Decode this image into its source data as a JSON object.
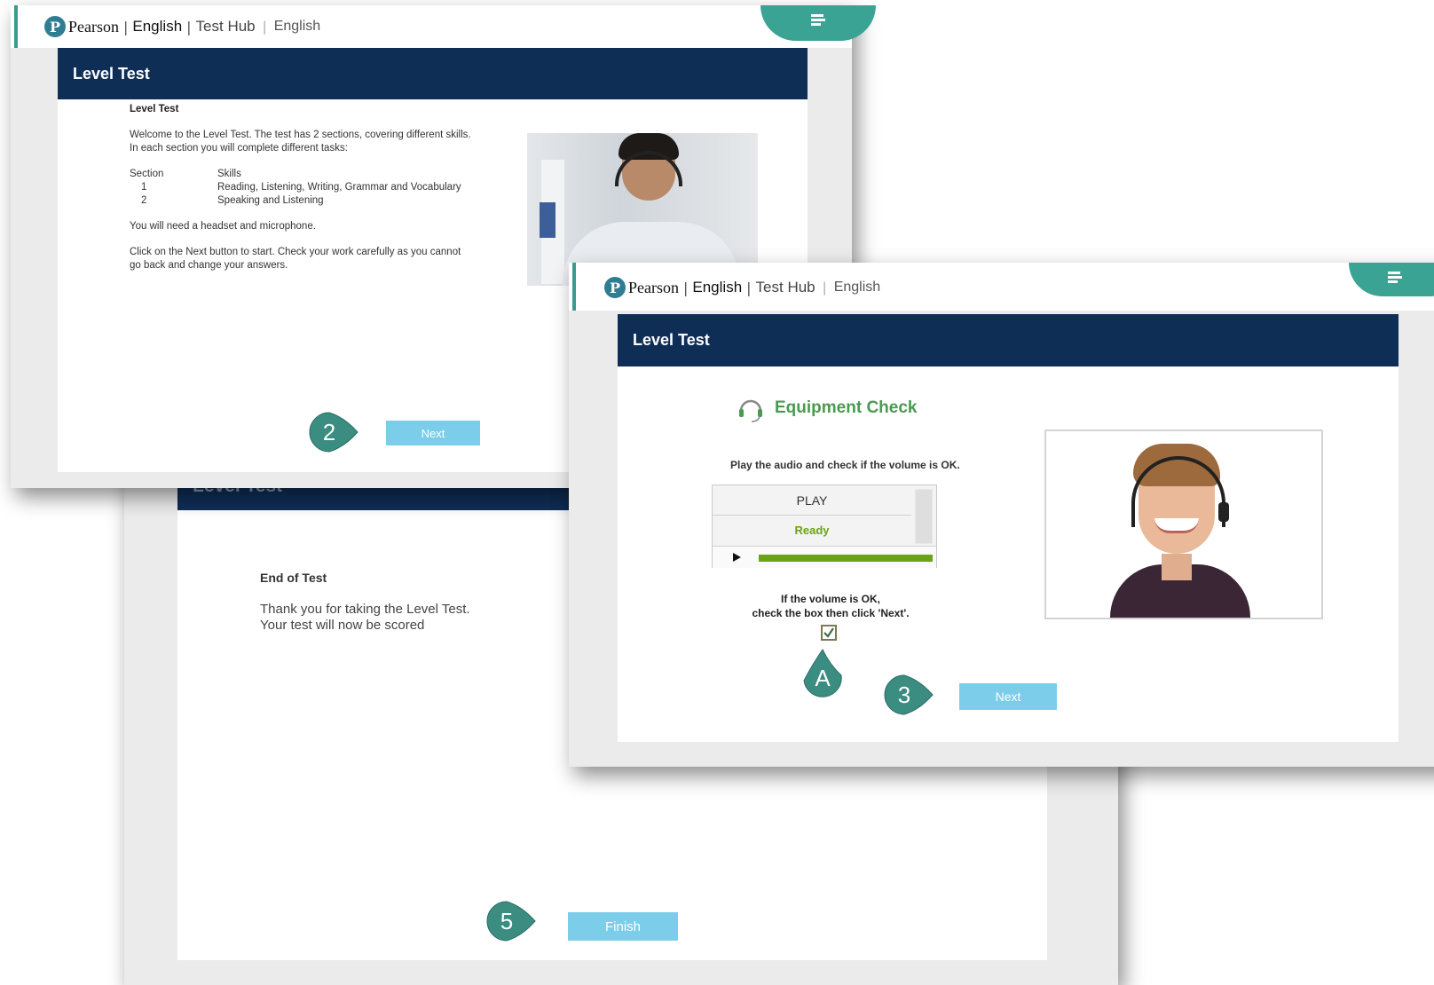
{
  "brand": {
    "logo_letter": "P",
    "pearson": "Pearson",
    "english": "English",
    "test_hub": "Test Hub",
    "language": "English",
    "separator": "|"
  },
  "colors": {
    "title_bar": "#0f2e56",
    "teal": "#3aa394",
    "button": "#7ccdea",
    "equipment_green": "#4a9a4f",
    "ready_green": "#6aa315"
  },
  "screen_end": {
    "title": "Level Test",
    "heading": "End of Test",
    "line1": "Thank you for taking the Level Test.",
    "line2": "Your test will now be scored",
    "finish_label": "Finish",
    "step": "5"
  },
  "screen_intro": {
    "title": "Level Test",
    "heading": "Level Test",
    "welcome1": "Welcome to the Level Test. The test has 2 sections, covering different skills.",
    "welcome2": "In each section you will complete different tasks:",
    "col_section": "Section",
    "col_skills": "Skills",
    "rows": [
      {
        "section": "1",
        "skills": "Reading, Listening, Writing, Grammar and Vocabulary"
      },
      {
        "section": "2",
        "skills": "Speaking and Listening"
      }
    ],
    "headset_note": "You will need a headset and microphone.",
    "next_note1": "Click on the Next button to start. Check your work carefully as you cannot",
    "next_note2": "go back and change your answers.",
    "next_label": "Next",
    "step": "2"
  },
  "screen_equipment": {
    "title": "Level Test",
    "heading": "Equipment Check",
    "instruction": "Play the audio and check if the volume is OK.",
    "play_label": "PLAY",
    "status": "Ready",
    "volume_level": 1.0,
    "confirm1": "If the volume is OK,",
    "confirm2": "check the box then click 'Next'.",
    "checkbox_checked": true,
    "next_label": "Next",
    "step": "3",
    "marker_a": "A"
  },
  "icons": {
    "menu": "hamburger-menu-icon",
    "headset": "headset-icon",
    "play": "play-triangle-icon",
    "check": "checkmark-icon"
  }
}
